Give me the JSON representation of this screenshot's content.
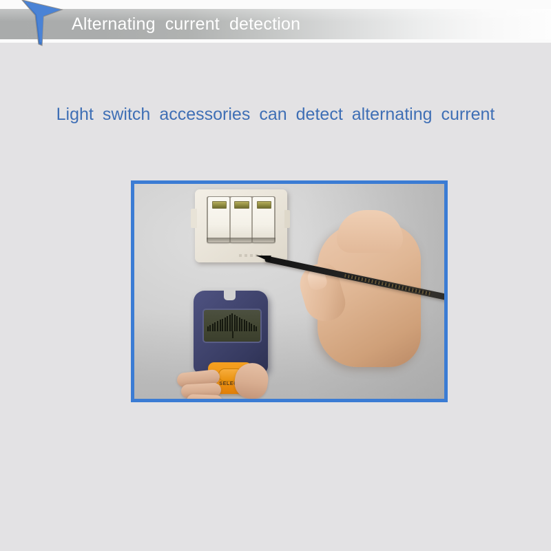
{
  "header": {
    "arrow_icon": "down-arrow-icon",
    "title": "Alternating current detection",
    "title_words": [
      "Alternating",
      "current",
      "detection"
    ],
    "bar_color_left": "#a9abab",
    "bar_color_right": "#fdfdfd",
    "title_color": "#ffffff",
    "arrow_color": "#3b74c8"
  },
  "subtitle": {
    "text": "Light switch accessories can detect alternating current",
    "words": [
      "Light",
      "switch",
      "accessories",
      "can",
      "detect",
      "alternating",
      "current"
    ],
    "color": "#3f6fb5"
  },
  "photo": {
    "border_color": "#3b7cd4",
    "alt": "Hand holding a black probe pen next to a wall light switch while another hand holds a blue and orange wall detector",
    "wall_switch": {
      "name": "three-gang-light-switch",
      "rockers": 3,
      "body_color": "#eae5da",
      "indicator_color": "#8e8a3f"
    },
    "detector": {
      "name": "wall-stud-ac-detector",
      "body_color": "#424670",
      "accent_color": "#ef9414",
      "screen_color": "#434733",
      "button_label": "SELECT",
      "scale_bars": 21
    },
    "pen": {
      "name": "probe-pen",
      "color": "#1d1d1d"
    }
  },
  "page": {
    "background_color": "#e3e2e4"
  }
}
